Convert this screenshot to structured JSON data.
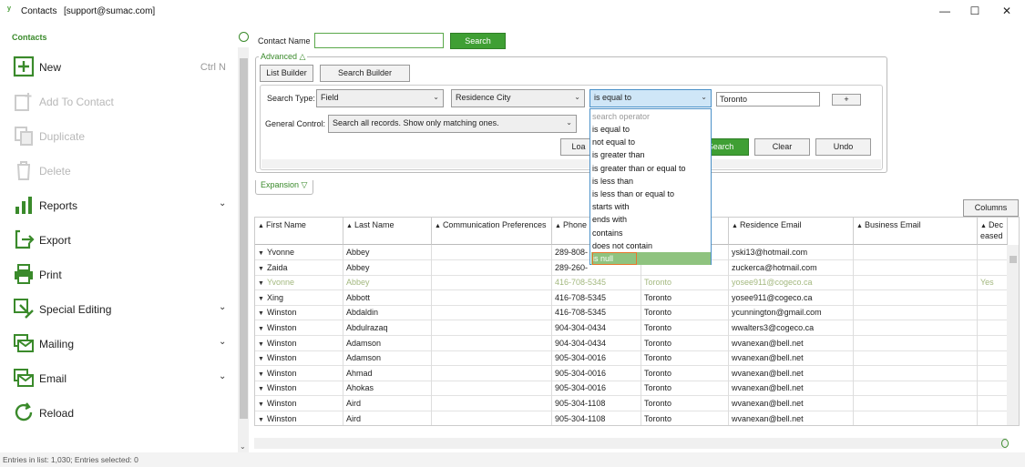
{
  "window": {
    "title": "Contacts",
    "account": "[support@sumac.com]",
    "minimize": "—",
    "maximize": "☐",
    "close": "✕"
  },
  "sidebar": {
    "heading": "Contacts",
    "items": [
      {
        "label": "New",
        "shortcut": "Ctrl N",
        "icon": "plus-box-icon",
        "enabled": true
      },
      {
        "label": "Add To Contact",
        "icon": "add-contact-icon",
        "enabled": false
      },
      {
        "label": "Duplicate",
        "icon": "duplicate-icon",
        "enabled": false
      },
      {
        "label": "Delete",
        "icon": "trash-icon",
        "enabled": false
      },
      {
        "label": "Reports",
        "icon": "bar-chart-icon",
        "enabled": true,
        "expandable": true
      },
      {
        "label": "Export",
        "icon": "export-icon",
        "enabled": true
      },
      {
        "label": "Print",
        "icon": "printer-icon",
        "enabled": true
      },
      {
        "label": "Special Editing",
        "icon": "special-edit-icon",
        "enabled": true,
        "expandable": true
      },
      {
        "label": "Mailing",
        "icon": "mail-icon",
        "enabled": true,
        "expandable": true
      },
      {
        "label": "Email",
        "icon": "email-icon",
        "enabled": true,
        "expandable": true
      },
      {
        "label": "Reload",
        "icon": "reload-icon",
        "enabled": true
      }
    ]
  },
  "search": {
    "contact_name_label": "Contact Name",
    "contact_name_value": "",
    "search_button": "Search"
  },
  "advanced": {
    "title": "Advanced △",
    "list_builder": "List Builder",
    "search_builder": "Search Builder",
    "search_type_label": "Search Type:",
    "search_type_value": "Field",
    "field_value": "Residence City",
    "operator_value": "is equal to",
    "criteria_value": "Toronto",
    "add_button": "+",
    "general_control_label": "General Control:",
    "general_control_value": "Search all records. Show only matching ones.",
    "load_button": "Loa",
    "search_button": "Search",
    "clear_button": "Clear",
    "undo_button": "Undo"
  },
  "operator_dropdown": {
    "placeholder": "search operator",
    "options": [
      "is equal to",
      "not equal to",
      "is greater than",
      "is greater than or equal to",
      "is less than",
      "is less than or equal to",
      "starts with",
      "ends with",
      "contains",
      "does not contain",
      "is null"
    ],
    "highlighted": "is null"
  },
  "expansion": {
    "title": "Expansion ▽"
  },
  "columns_button": "Columns",
  "table": {
    "headers": [
      "First Name",
      "Last Name",
      "Communication Preferences",
      "Phone",
      "",
      "Residence Email",
      "Business Email",
      "Dec eased"
    ],
    "rows": [
      {
        "first": "Yvonne",
        "last": "Abbey",
        "comm": "",
        "phone": "289-808-",
        "city": "",
        "email": "yski13@hotmail.com",
        "bemail": "",
        "deceased": "",
        "dead": false
      },
      {
        "first": "Zaida",
        "last": "Abbey",
        "comm": "",
        "phone": "289-260-",
        "city": "",
        "email": "zuckerca@hotmail.com",
        "bemail": "",
        "deceased": "",
        "dead": false
      },
      {
        "first": "Yvonne",
        "last": "Abbey",
        "comm": "",
        "phone": "416-708-5345",
        "city": "Toronto",
        "email": "yosee911@cogeco.ca",
        "bemail": "",
        "deceased": "Yes",
        "dead": true
      },
      {
        "first": "Xing",
        "last": "Abbott",
        "comm": "",
        "phone": "416-708-5345",
        "city": "Toronto",
        "email": "yosee911@cogeco.ca",
        "bemail": "",
        "deceased": "",
        "dead": false
      },
      {
        "first": "Winston",
        "last": "Abdaldin",
        "comm": "",
        "phone": "416-708-5345",
        "city": "Toronto",
        "email": "ycunnington@gmail.com",
        "bemail": "",
        "deceased": "",
        "dead": false
      },
      {
        "first": "Winston",
        "last": "Abdulrazaq",
        "comm": "",
        "phone": "904-304-0434",
        "city": "Toronto",
        "email": "wwalters3@cogeco.ca",
        "bemail": "",
        "deceased": "",
        "dead": false
      },
      {
        "first": "Winston",
        "last": "Adamson",
        "comm": "",
        "phone": "904-304-0434",
        "city": "Toronto",
        "email": "wvanexan@bell.net",
        "bemail": "",
        "deceased": "",
        "dead": false
      },
      {
        "first": "Winston",
        "last": "Adamson",
        "comm": "",
        "phone": "905-304-0016",
        "city": "Toronto",
        "email": "wvanexan@bell.net",
        "bemail": "",
        "deceased": "",
        "dead": false
      },
      {
        "first": "Winston",
        "last": "Ahmad",
        "comm": "",
        "phone": "905-304-0016",
        "city": "Toronto",
        "email": "wvanexan@bell.net",
        "bemail": "",
        "deceased": "",
        "dead": false
      },
      {
        "first": "Winston",
        "last": "Ahokas",
        "comm": "",
        "phone": "905-304-0016",
        "city": "Toronto",
        "email": "wvanexan@bell.net",
        "bemail": "",
        "deceased": "",
        "dead": false
      },
      {
        "first": "Winston",
        "last": "Aird",
        "comm": "",
        "phone": "905-304-1108",
        "city": "Toronto",
        "email": "wvanexan@bell.net",
        "bemail": "",
        "deceased": "",
        "dead": false
      },
      {
        "first": "Winston",
        "last": "Aird",
        "comm": "",
        "phone": "905-304-1108",
        "city": "Toronto",
        "email": "wvanexan@bell.net",
        "bemail": "",
        "deceased": "",
        "dead": false
      }
    ]
  },
  "status": "Entries in list: 1,030; Entries selected: 0",
  "colors": {
    "accent": "#3f9f34",
    "deceased": "#a3b87f",
    "highlight": "#8fc37f",
    "hover_outline": "#e8762c"
  }
}
